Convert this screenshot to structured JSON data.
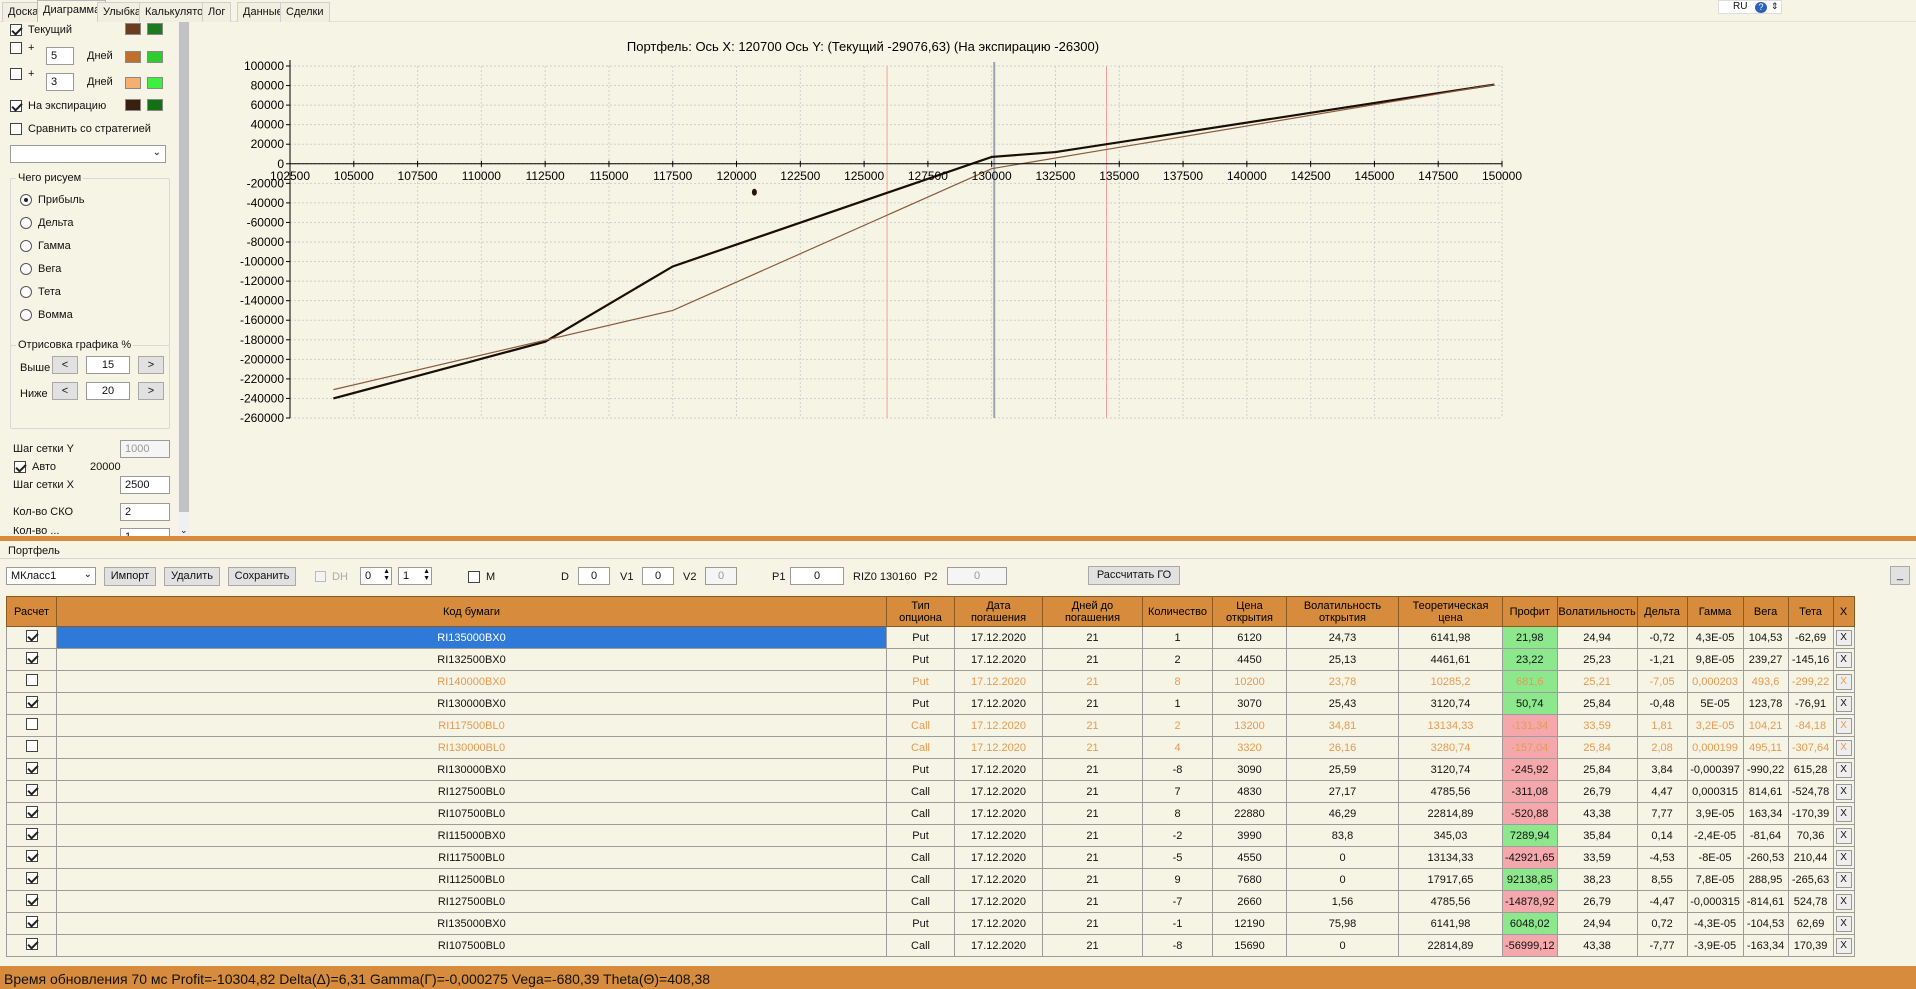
{
  "tabs": [
    "Доска",
    "Диаграмма",
    "Улыбка",
    "Калькулятор",
    "Лог",
    "Данные",
    "Сделки"
  ],
  "active_tab": "Диаграмма",
  "lang": "RU",
  "left_panel": {
    "current_label": "Текущий",
    "plus": "+",
    "days_label": "Дней",
    "days1": "5",
    "days2": "3",
    "expiry_label": "На экспирацию",
    "compare_label": "Сравнить со стратегией",
    "draw_group_title": "Чего рисуем",
    "radios": [
      "Прибыль",
      "Дельта",
      "Гамма",
      "Вега",
      "Тета",
      "Вомма"
    ],
    "render_group_title": "Отрисовка графика %",
    "above_label": "Выше",
    "above_value": "15",
    "below_label": "Ниже",
    "below_value": "20",
    "lt": "<",
    "gt": ">",
    "grid_y_label": "Шаг сетки Y",
    "grid_y_value": "1000",
    "auto_label": "Авто",
    "auto_value": "20000",
    "grid_x_label": "Шаг сетки X",
    "grid_x_value": "2500",
    "sko_label": "Кол-во СКО",
    "sko_value": "2",
    "partial_label": "Кол-во ...",
    "partial_value": "1",
    "colors": {
      "current_a": "#6b3d1e",
      "current_b": "#1e7a1e",
      "d5_a": "#c0702a",
      "d5_b": "#2ecc2e",
      "d3_a": "#f5b070",
      "d3_b": "#3ef03e",
      "exp_a": "#3a200c",
      "exp_b": "#137013"
    }
  },
  "chart_data": {
    "type": "line",
    "title": "Портфель: Ось X:  120700 Ось Y:  (Текущий -29076,63)  (На экспирацию -26300)",
    "x_ticks": [
      "102500",
      "105000",
      "107500",
      "110000",
      "112500",
      "115000",
      "117500",
      "120000",
      "122500",
      "125000",
      "127500",
      "130000",
      "132500",
      "135000",
      "137500",
      "140000",
      "142500",
      "145000",
      "147500",
      "150000"
    ],
    "y_ticks": [
      "100000",
      "80000",
      "60000",
      "40000",
      "20000",
      "0",
      "-20000",
      "-40000",
      "-60000",
      "-80000",
      "-100000",
      "-120000",
      "-140000",
      "-160000",
      "-180000",
      "-200000",
      "-220000",
      "-240000",
      "-260000"
    ],
    "xlim": [
      102500,
      150000
    ],
    "ylim": [
      -260000,
      100000
    ],
    "grid": true,
    "vlines_red": [
      125900,
      134500
    ],
    "vline_current": 130100,
    "marker_point": {
      "x": 120700,
      "y": -29076.63
    },
    "series": [
      {
        "color": "#1a0d05",
        "x": [
          104200,
          112500,
          117500,
          130000,
          132500,
          149700
        ],
        "y": [
          -240000,
          -182000,
          -105000,
          7000,
          12000,
          81000
        ]
      },
      {
        "color": "#8a5a3a",
        "x": [
          104200,
          117500,
          130000,
          149700
        ],
        "y": [
          -231000,
          -150000,
          -5000,
          81000
        ]
      }
    ]
  },
  "portfolio": {
    "label": "Портфель",
    "class_select": "МКласс1",
    "import": "Импорт",
    "delete": "Удалить",
    "save": "Сохранить",
    "dh": "DH",
    "dh_v1": "0",
    "dh_v2": "1",
    "m": "M",
    "d_label": "D",
    "d_value": "0",
    "v1_label": "V1",
    "v1_value": "0",
    "v2_label": "V2",
    "v2_value": "0",
    "p1_label": "P1",
    "p1_value": "0",
    "instrument": "RIZ0 130160",
    "p2_label": "P2",
    "p2_value": "0",
    "calc_go": "Рассчитать ГО",
    "collapse": "_"
  },
  "table": {
    "headers": [
      "Расчет",
      "Код бумаги",
      "Тип\nопциона",
      "Дата\nпогашения",
      "Дней до\nпогашения",
      "Количество",
      "Цена\nоткрытия",
      "Волатильность\nоткрытия",
      "Теоретическая\nцена",
      "Профит",
      "Волатильность",
      "Дельта",
      "Гамма",
      "Вега",
      "Тета",
      "X"
    ],
    "rows": [
      {
        "chk": true,
        "cells": [
          "RI135000BX0",
          "Put",
          "17.12.2020",
          "21",
          "1",
          "6120",
          "24,73",
          "6141,98",
          "21,98",
          "24,94",
          "-0,72",
          "4,3E-05",
          "104,53",
          "-62,69"
        ],
        "p": "pos",
        "sel": true
      },
      {
        "chk": true,
        "cells": [
          "RI132500BX0",
          "Put",
          "17.12.2020",
          "21",
          "2",
          "4450",
          "25,13",
          "4461,61",
          "23,22",
          "25,23",
          "-1,21",
          "9,8E-05",
          "239,27",
          "-145,16"
        ],
        "p": "pos"
      },
      {
        "chk": false,
        "dim": true,
        "cells": [
          "RI140000BX0",
          "Put",
          "17.12.2020",
          "21",
          "8",
          "10200",
          "23,78",
          "10285,2",
          "681,6",
          "25,21",
          "-7,05",
          "0,000203",
          "493,6",
          "-299,22"
        ],
        "p": "pos"
      },
      {
        "chk": true,
        "cells": [
          "RI130000BX0",
          "Put",
          "17.12.2020",
          "21",
          "1",
          "3070",
          "25,43",
          "3120,74",
          "50,74",
          "25,84",
          "-0,48",
          "5E-05",
          "123,78",
          "-76,91"
        ],
        "p": "pos"
      },
      {
        "chk": false,
        "dim": true,
        "cells": [
          "RI117500BL0",
          "Call",
          "17.12.2020",
          "21",
          "2",
          "13200",
          "34,81",
          "13134,33",
          "-131,34",
          "33,59",
          "1,81",
          "3,2E-05",
          "104,21",
          "-84,18"
        ],
        "p": "neg"
      },
      {
        "chk": false,
        "dim": true,
        "cells": [
          "RI130000BL0",
          "Call",
          "17.12.2020",
          "21",
          "4",
          "3320",
          "26,16",
          "3280,74",
          "-157,04",
          "25,84",
          "2,08",
          "0,000199",
          "495,11",
          "-307,64"
        ],
        "p": "neg"
      },
      {
        "chk": true,
        "cells": [
          "RI130000BX0",
          "Put",
          "17.12.2020",
          "21",
          "-8",
          "3090",
          "25,59",
          "3120,74",
          "-245,92",
          "25,84",
          "3,84",
          "-0,000397",
          "-990,22",
          "615,28"
        ],
        "p": "neg"
      },
      {
        "chk": true,
        "cells": [
          "RI127500BL0",
          "Call",
          "17.12.2020",
          "21",
          "7",
          "4830",
          "27,17",
          "4785,56",
          "-311,08",
          "26,79",
          "4,47",
          "0,000315",
          "814,61",
          "-524,78"
        ],
        "p": "neg"
      },
      {
        "chk": true,
        "cells": [
          "RI107500BL0",
          "Call",
          "17.12.2020",
          "21",
          "8",
          "22880",
          "46,29",
          "22814,89",
          "-520,88",
          "43,38",
          "7,77",
          "3,9E-05",
          "163,34",
          "-170,39"
        ],
        "p": "neg"
      },
      {
        "chk": true,
        "cells": [
          "RI115000BX0",
          "Put",
          "17.12.2020",
          "21",
          "-2",
          "3990",
          "83,8",
          "345,03",
          "7289,94",
          "35,84",
          "0,14",
          "-2,4E-05",
          "-81,64",
          "70,36"
        ],
        "p": "pos"
      },
      {
        "chk": true,
        "cells": [
          "RI117500BL0",
          "Call",
          "17.12.2020",
          "21",
          "-5",
          "4550",
          "0",
          "13134,33",
          "-42921,65",
          "33,59",
          "-4,53",
          "-8E-05",
          "-260,53",
          "210,44"
        ],
        "p": "neg"
      },
      {
        "chk": true,
        "cells": [
          "RI112500BL0",
          "Call",
          "17.12.2020",
          "21",
          "9",
          "7680",
          "0",
          "17917,65",
          "92138,85",
          "38,23",
          "8,55",
          "7,8E-05",
          "288,95",
          "-265,63"
        ],
        "p": "pos"
      },
      {
        "chk": true,
        "cells": [
          "RI127500BL0",
          "Call",
          "17.12.2020",
          "21",
          "-7",
          "2660",
          "1,56",
          "4785,56",
          "-14878,92",
          "26,79",
          "-4,47",
          "-0,000315",
          "-814,61",
          "524,78"
        ],
        "p": "neg"
      },
      {
        "chk": true,
        "cells": [
          "RI135000BX0",
          "Put",
          "17.12.2020",
          "21",
          "-1",
          "12190",
          "75,98",
          "6141,98",
          "6048,02",
          "24,94",
          "0,72",
          "-4,3E-05",
          "-104,53",
          "62,69"
        ],
        "p": "pos"
      },
      {
        "chk": true,
        "cells": [
          "RI107500BL0",
          "Call",
          "17.12.2020",
          "21",
          "-8",
          "15690",
          "0",
          "22814,89",
          "-56999,12",
          "43,38",
          "-7,77",
          "-3,9E-05",
          "-163,34",
          "170,39"
        ],
        "p": "neg"
      }
    ],
    "x_button": "X"
  },
  "status": "Время обновления 70 мс  Profit=-10304,82 Delta(Δ)=6,31 Gamma(Γ)=-0,000275 Vega=-680,39 Theta(Θ)=408,38"
}
